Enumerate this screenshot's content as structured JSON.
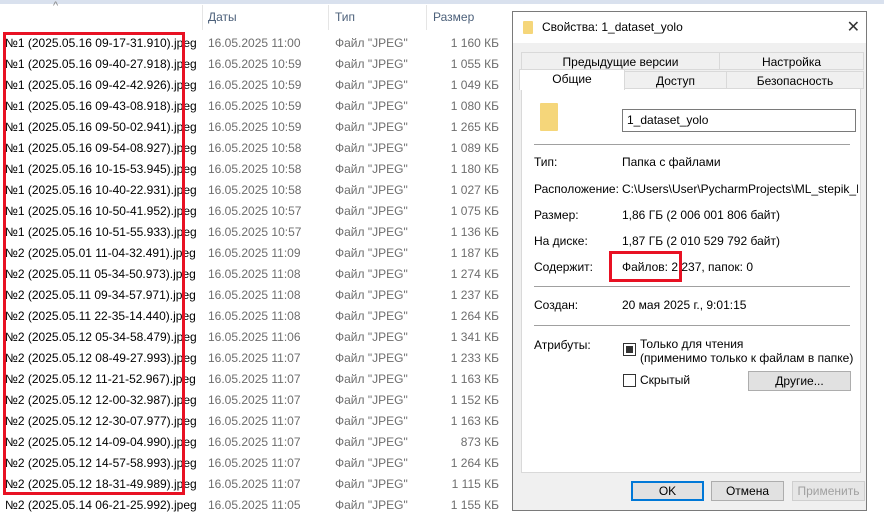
{
  "explorer": {
    "columns": {
      "date": "Даты",
      "type": "Тип",
      "size": "Размер"
    },
    "rows": [
      {
        "name": "№1 (2025.05.16 09-17-31.910).jpeg",
        "date": "16.05.2025 11:00",
        "type": "Файл \"JPEG\"",
        "size": "1 160 КБ"
      },
      {
        "name": "№1 (2025.05.16 09-40-27.918).jpeg",
        "date": "16.05.2025 10:59",
        "type": "Файл \"JPEG\"",
        "size": "1 055 КБ"
      },
      {
        "name": "№1 (2025.05.16 09-42-42.926).jpeg",
        "date": "16.05.2025 10:59",
        "type": "Файл \"JPEG\"",
        "size": "1 049 КБ"
      },
      {
        "name": "№1 (2025.05.16 09-43-08.918).jpeg",
        "date": "16.05.2025 10:59",
        "type": "Файл \"JPEG\"",
        "size": "1 080 КБ"
      },
      {
        "name": "№1 (2025.05.16 09-50-02.941).jpeg",
        "date": "16.05.2025 10:59",
        "type": "Файл \"JPEG\"",
        "size": "1 265 КБ"
      },
      {
        "name": "№1 (2025.05.16 09-54-08.927).jpeg",
        "date": "16.05.2025 10:58",
        "type": "Файл \"JPEG\"",
        "size": "1 089 КБ"
      },
      {
        "name": "№1 (2025.05.16 10-15-53.945).jpeg",
        "date": "16.05.2025 10:58",
        "type": "Файл \"JPEG\"",
        "size": "1 180 КБ"
      },
      {
        "name": "№1 (2025.05.16 10-40-22.931).jpeg",
        "date": "16.05.2025 10:58",
        "type": "Файл \"JPEG\"",
        "size": "1 027 КБ"
      },
      {
        "name": "№1 (2025.05.16 10-50-41.952).jpeg",
        "date": "16.05.2025 10:57",
        "type": "Файл \"JPEG\"",
        "size": "1 075 КБ"
      },
      {
        "name": "№1 (2025.05.16 10-51-55.933).jpeg",
        "date": "16.05.2025 10:57",
        "type": "Файл \"JPEG\"",
        "size": "1 136 КБ"
      },
      {
        "name": "№2 (2025.05.01 11-04-32.491).jpeg",
        "date": "16.05.2025 11:09",
        "type": "Файл \"JPEG\"",
        "size": "1 187 КБ"
      },
      {
        "name": "№2 (2025.05.11 05-34-50.973).jpeg",
        "date": "16.05.2025 11:08",
        "type": "Файл \"JPEG\"",
        "size": "1 274 КБ"
      },
      {
        "name": "№2 (2025.05.11 09-34-57.971).jpeg",
        "date": "16.05.2025 11:08",
        "type": "Файл \"JPEG\"",
        "size": "1 237 КБ"
      },
      {
        "name": "№2 (2025.05.11 22-35-14.440).jpeg",
        "date": "16.05.2025 11:08",
        "type": "Файл \"JPEG\"",
        "size": "1 264 КБ"
      },
      {
        "name": "№2 (2025.05.12 05-34-58.479).jpeg",
        "date": "16.05.2025 11:06",
        "type": "Файл \"JPEG\"",
        "size": "1 341 КБ"
      },
      {
        "name": "№2 (2025.05.12 08-49-27.993).jpeg",
        "date": "16.05.2025 11:07",
        "type": "Файл \"JPEG\"",
        "size": "1 233 КБ"
      },
      {
        "name": "№2 (2025.05.12 11-21-52.967).jpeg",
        "date": "16.05.2025 11:07",
        "type": "Файл \"JPEG\"",
        "size": "1 163 КБ"
      },
      {
        "name": "№2 (2025.05.12 12-00-32.987).jpeg",
        "date": "16.05.2025 11:07",
        "type": "Файл \"JPEG\"",
        "size": "1 152 КБ"
      },
      {
        "name": "№2 (2025.05.12 12-30-07.977).jpeg",
        "date": "16.05.2025 11:07",
        "type": "Файл \"JPEG\"",
        "size": "1 163 КБ"
      },
      {
        "name": "№2 (2025.05.12 14-09-04.990).jpeg",
        "date": "16.05.2025 11:07",
        "type": "Файл \"JPEG\"",
        "size": "873 КБ"
      },
      {
        "name": "№2 (2025.05.12 14-57-58.993).jpeg",
        "date": "16.05.2025 11:07",
        "type": "Файл \"JPEG\"",
        "size": "1 264 КБ"
      },
      {
        "name": "№2 (2025.05.12 18-31-49.989).jpeg",
        "date": "16.05.2025 11:07",
        "type": "Файл \"JPEG\"",
        "size": "1 115 КБ"
      },
      {
        "name": "№2 (2025.05.14 06-21-25.992).jpeg",
        "date": "16.05.2025 11:05",
        "type": "Файл \"JPEG\"",
        "size": "1 155 КБ"
      }
    ]
  },
  "dialog": {
    "title": "Свойства: 1_dataset_yolo",
    "tabs_row1": [
      "Предыдущие версии",
      "Настройка"
    ],
    "tabs_row2": [
      "Общие",
      "Доступ",
      "Безопасность"
    ],
    "folder_name": "1_dataset_yolo",
    "type_label": "Тип:",
    "type_value": "Папка с файлами",
    "location_label": "Расположение:",
    "location_value": "C:\\Users\\User\\PycharmProjects\\ML_stepik_Dubi",
    "size_label": "Размер:",
    "size_value": "1,86 ГБ (2 006 001 806 байт)",
    "disk_label": "На диске:",
    "disk_value": "1,87 ГБ (2 010 529 792 байт)",
    "contains_label": "Содержит:",
    "contains_files": "Файлов: 2 237",
    "contains_folders": ", папок: 0",
    "created_label": "Создан:",
    "created_value": "20 мая 2025 г., 9:01:15",
    "attributes_label": "Атрибуты:",
    "readonly_label": "Только для чтения",
    "readonly_note": "(применимо только к файлам в папке)",
    "hidden_label": "Скрытый",
    "other_button": "Другие...",
    "ok": "OK",
    "cancel": "Отмена",
    "apply": "Применить"
  },
  "colors": {
    "highlight": "#e81123",
    "accent": "#0078d7"
  }
}
